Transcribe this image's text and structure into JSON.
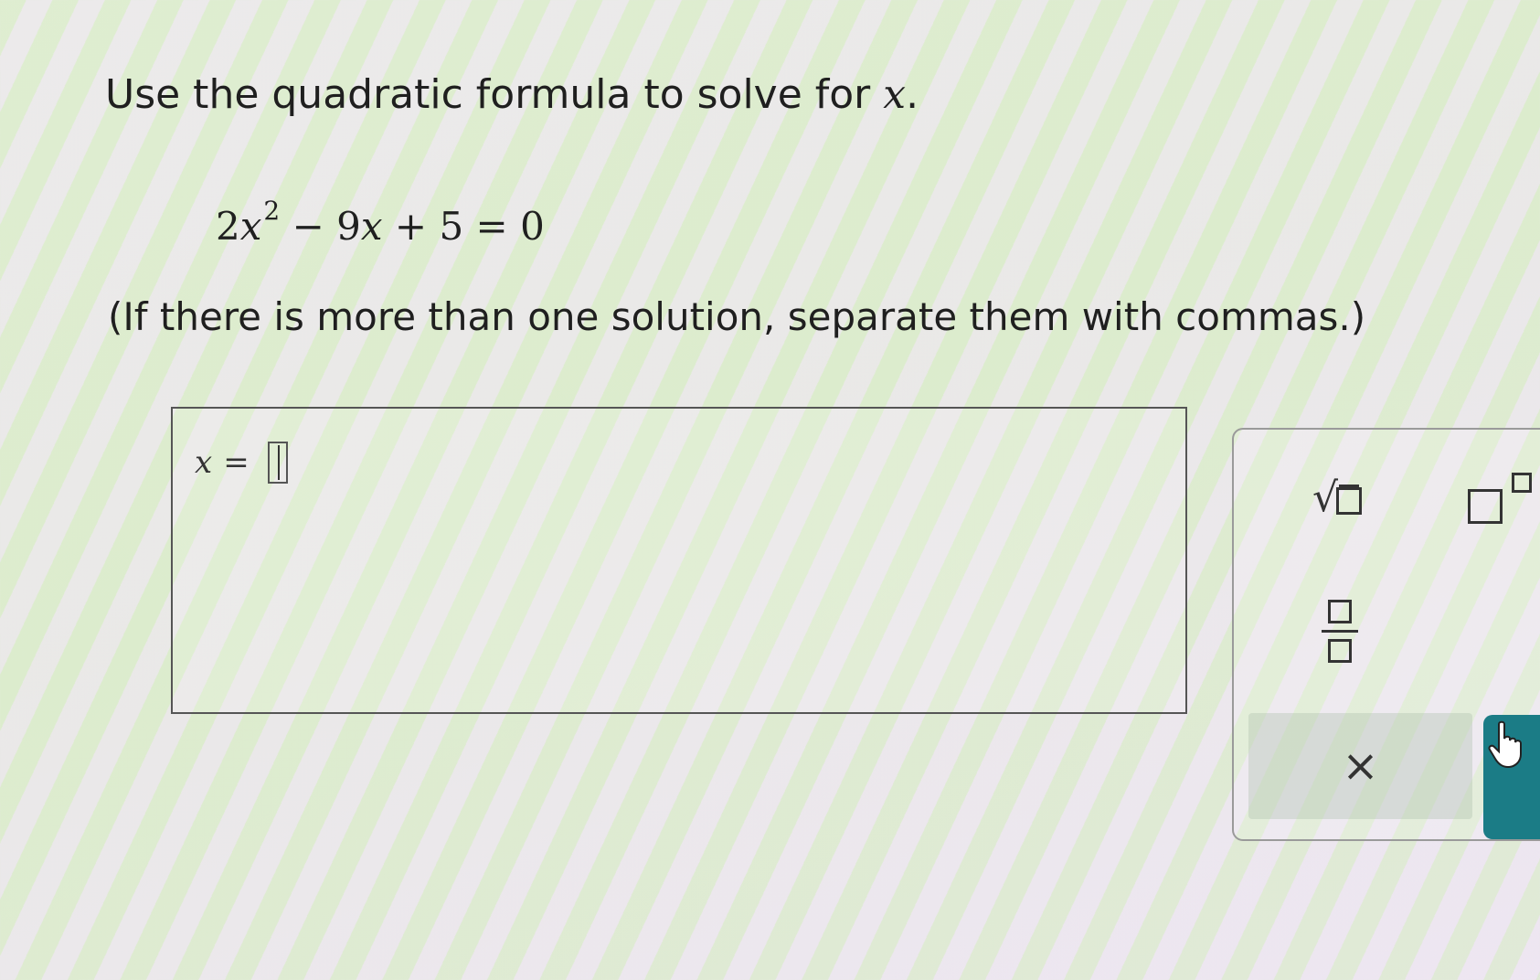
{
  "question": {
    "prompt_text": "Use the quadratic formula to solve for ",
    "prompt_var": "x",
    "prompt_end": ".",
    "equation": {
      "coef": "2",
      "var": "x",
      "exponent": "2",
      "rest": " − 9",
      "rest_var": "x",
      "tail": " + 5 = 0"
    },
    "note": "(If there is more than one solution, separate them with commas.)"
  },
  "answer": {
    "label_var": "x",
    "eq_sign": "=",
    "value": ""
  },
  "toolbar": {
    "sqrt_radical": "√",
    "clear_symbol": "×"
  },
  "icons": {
    "sqrt": "square-root-icon",
    "power": "exponent-icon",
    "fraction": "fraction-icon",
    "clear": "clear-icon",
    "cursor": "hand-pointer-icon"
  },
  "colors": {
    "check_button": "#1b7c86"
  }
}
